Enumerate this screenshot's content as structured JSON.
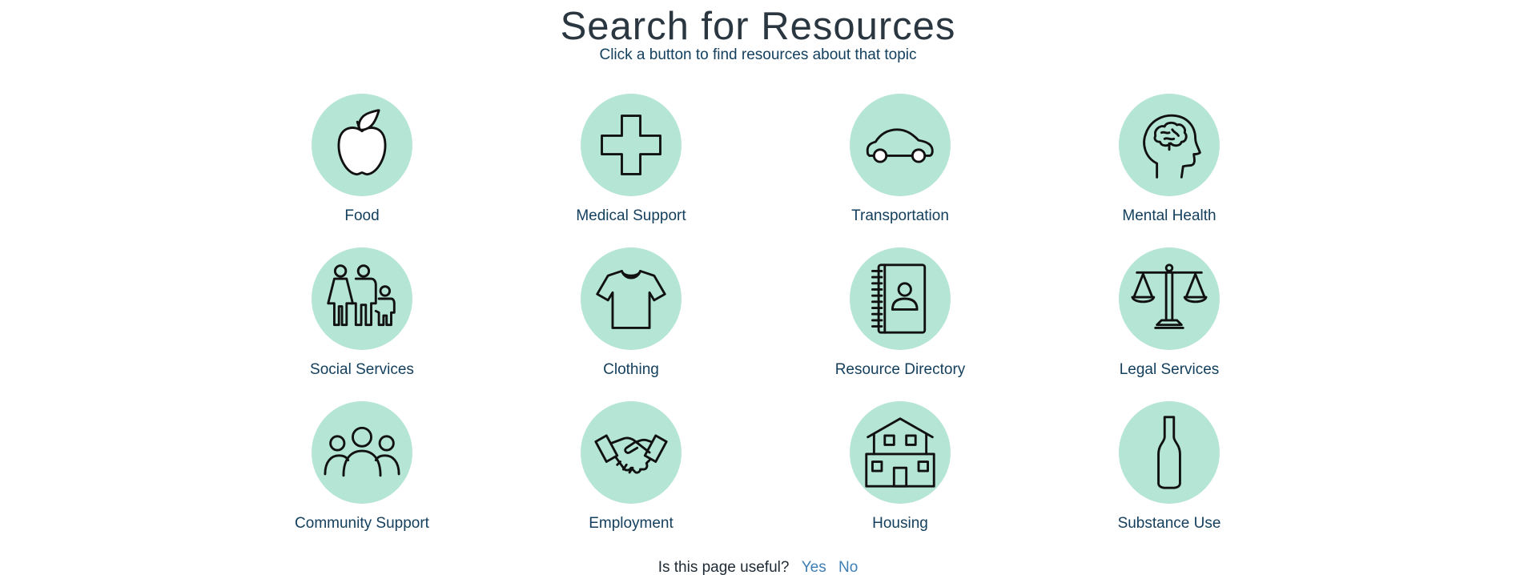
{
  "header": {
    "title": "Search for Resources",
    "subtitle": "Click a button to find resources about that topic"
  },
  "accent_color": "#b5e5d4",
  "label_color": "#14405e",
  "link_color": "#3f7fb5",
  "tiles": [
    {
      "label": "Food",
      "icon": "apple-icon"
    },
    {
      "label": "Medical Support",
      "icon": "medical-cross-icon"
    },
    {
      "label": "Transportation",
      "icon": "car-icon"
    },
    {
      "label": "Mental Health",
      "icon": "brain-head-icon"
    },
    {
      "label": "Social Services",
      "icon": "family-icon"
    },
    {
      "label": "Clothing",
      "icon": "tshirt-icon"
    },
    {
      "label": "Resource Directory",
      "icon": "address-book-icon"
    },
    {
      "label": "Legal Services",
      "icon": "scales-icon"
    },
    {
      "label": "Community Support",
      "icon": "group-icon"
    },
    {
      "label": "Employment",
      "icon": "handshake-icon"
    },
    {
      "label": "Housing",
      "icon": "house-icon"
    },
    {
      "label": "Substance Use",
      "icon": "bottle-icon"
    }
  ],
  "feedback": {
    "question": "Is this page useful?",
    "yes_label": "Yes",
    "no_label": "No"
  }
}
